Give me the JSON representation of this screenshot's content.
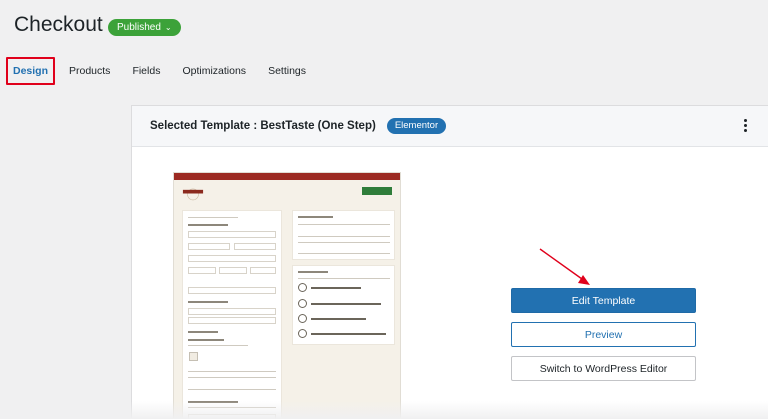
{
  "header": {
    "title": "Checkout",
    "status": "Published"
  },
  "tabs": [
    {
      "label": "Design"
    },
    {
      "label": "Products"
    },
    {
      "label": "Fields"
    },
    {
      "label": "Optimizations"
    },
    {
      "label": "Settings"
    }
  ],
  "template": {
    "selected_label": "Selected Template :  BestTaste  (One Step)",
    "builder_badge": "Elementor"
  },
  "actions": {
    "edit": "Edit Template",
    "preview": "Preview",
    "switch": "Switch to WordPress Editor"
  },
  "colors": {
    "primary": "#2271b1",
    "published": "#3ca239",
    "highlight": "#e0001b"
  }
}
